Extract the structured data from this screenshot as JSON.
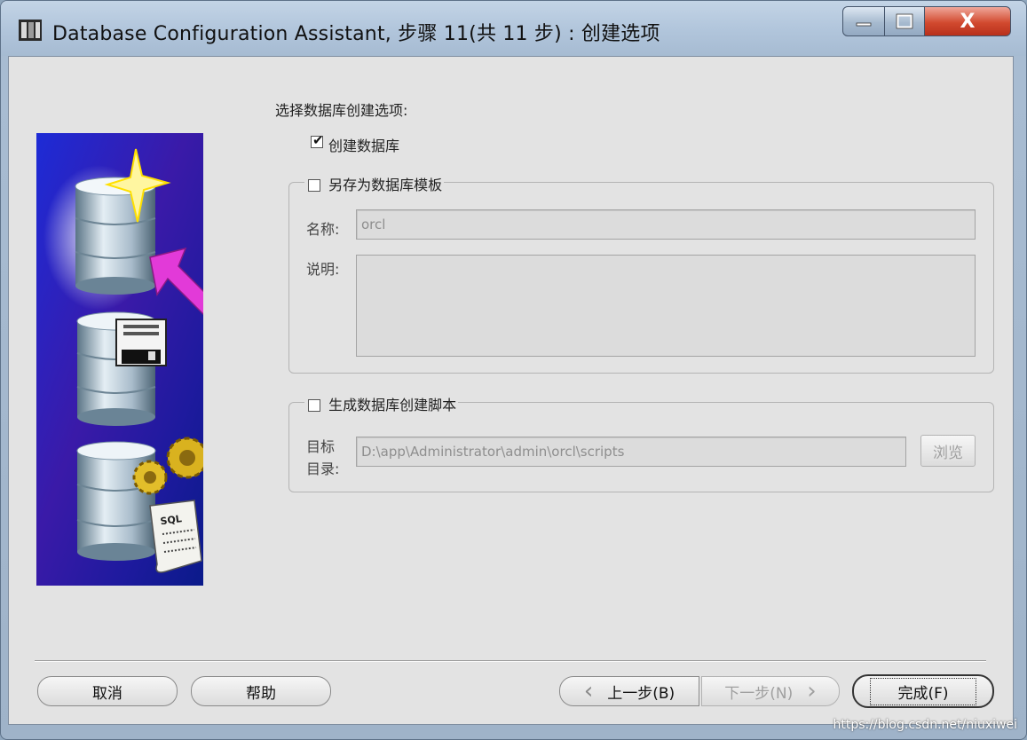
{
  "window": {
    "title": "Database Configuration Assistant, 步骤 11(共 11 步) : 创建选项",
    "close_symbol": "X"
  },
  "prompt": "选择数据库创建选项:",
  "create_db": {
    "label": "创建数据库",
    "checked": true
  },
  "save_template": {
    "label": "另存为数据库模板",
    "checked": false,
    "name_label": "名称:",
    "name_value": "orcl",
    "desc_label": "说明:",
    "desc_value": ""
  },
  "gen_scripts": {
    "label": "生成数据库创建脚本",
    "checked": false,
    "dir_label_line1": "目标",
    "dir_label_line2": "目录:",
    "dir_value": "D:\\app\\Administrator\\admin\\orcl\\scripts",
    "browse_label": "浏览"
  },
  "footer": {
    "cancel": "取消",
    "help": "帮助",
    "back": "上一步(B)",
    "next": "下一步(N)",
    "finish": "完成(F)",
    "back_arrow": "‹",
    "next_arrow": "›"
  },
  "illustration": {
    "sql_text": "SQL"
  },
  "watermark": "https://blog.csdn.net/niuxiwei"
}
